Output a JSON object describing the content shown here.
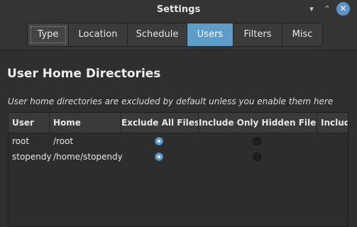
{
  "window": {
    "title": "Settings",
    "min_glyph": "▾",
    "max_glyph": "⌃",
    "close_glyph": "✕"
  },
  "tabs": [
    {
      "label": "Type",
      "state": "focused"
    },
    {
      "label": "Location",
      "state": "normal"
    },
    {
      "label": "Schedule",
      "state": "normal"
    },
    {
      "label": "Users",
      "state": "active"
    },
    {
      "label": "Filters",
      "state": "normal"
    },
    {
      "label": "Misc",
      "state": "normal"
    }
  ],
  "section": {
    "heading": "User Home Directories",
    "description": "User home directories are excluded by default unless you enable them here"
  },
  "table": {
    "columns": [
      "User",
      "Home",
      "Exclude All Files",
      "Include Only Hidden Files",
      "Includ"
    ],
    "rows": [
      {
        "user": "root",
        "home": "/root",
        "exclude_all": true,
        "include_hidden": false
      },
      {
        "user": "stopendy",
        "home": "/home/stopendy",
        "exclude_all": true,
        "include_hidden": false
      }
    ]
  },
  "colors": {
    "accent": "#5f9dc9",
    "background": "#2f2f2f"
  }
}
